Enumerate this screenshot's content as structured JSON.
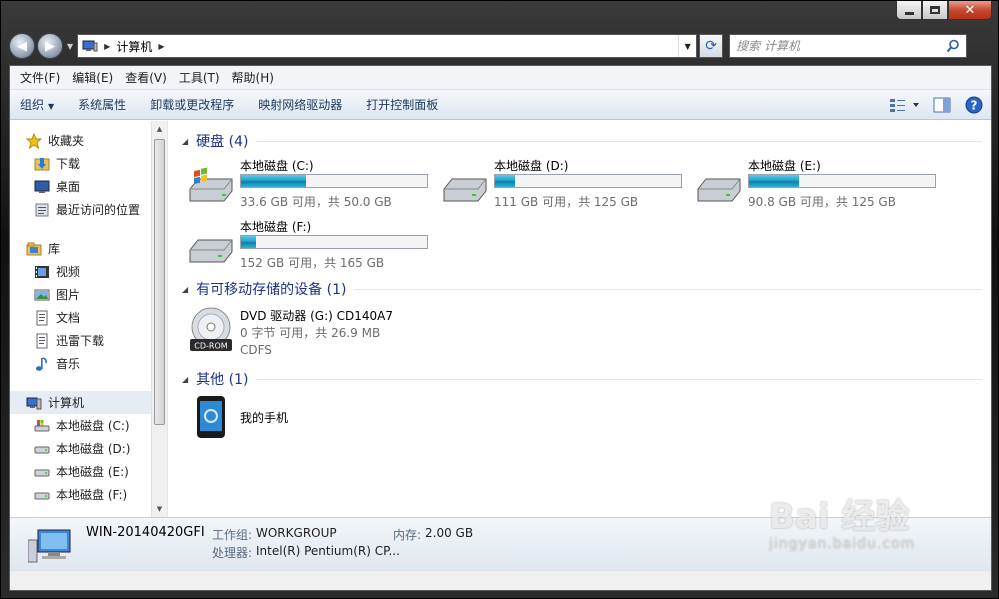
{
  "address": {
    "crumb": "计算机"
  },
  "search": {
    "placeholder": "搜索 计算机"
  },
  "menubar": [
    "文件(F)",
    "编辑(E)",
    "查看(V)",
    "工具(T)",
    "帮助(H)"
  ],
  "toolbar": {
    "organize": "组织",
    "items": [
      "系统属性",
      "卸载或更改程序",
      "映射网络驱动器",
      "打开控制面板"
    ]
  },
  "nav": {
    "favorites": "收藏夹",
    "fav_items": [
      "下载",
      "桌面",
      "最近访问的位置"
    ],
    "libraries": "库",
    "lib_items": [
      "视频",
      "图片",
      "文档",
      "迅雷下载",
      "音乐"
    ],
    "computer": "计算机",
    "computer_items": [
      "本地磁盘 (C:)",
      "本地磁盘 (D:)",
      "本地磁盘 (E:)",
      "本地磁盘 (F:)"
    ]
  },
  "groups": {
    "hdd": "硬盘 (4)",
    "removable": "有可移动存储的设备 (1)",
    "other": "其他 (1)"
  },
  "drives": [
    {
      "name": "本地磁盘 (C:)",
      "free": "33.6 GB 可用，共 50.0 GB",
      "fill": 0.35
    },
    {
      "name": "本地磁盘 (D:)",
      "free": "111 GB 可用，共 125 GB",
      "fill": 0.11
    },
    {
      "name": "本地磁盘 (E:)",
      "free": "90.8 GB 可用，共 125 GB",
      "fill": 0.27
    },
    {
      "name": "本地磁盘 (F:)",
      "free": "152 GB 可用，共 165 GB",
      "fill": 0.08
    }
  ],
  "dvd": {
    "name": "DVD 驱动器 (G:) CD140A7",
    "free": "0 字节 可用，共 26.9 MB",
    "fs": "CDFS",
    "label": "CD-ROM"
  },
  "phone": {
    "name": "我的手机"
  },
  "status": {
    "pc_name": "WIN-20140420GFI",
    "workgroup_label": "工作组:",
    "workgroup": "WORKGROUP",
    "memory_label": "内存:",
    "memory": "2.00 GB",
    "cpu_label": "处理器:",
    "cpu": "Intel(R) Pentium(R) CP..."
  },
  "watermark": {
    "brand": "Bai 经验",
    "url": "jingyan.baidu.com"
  }
}
